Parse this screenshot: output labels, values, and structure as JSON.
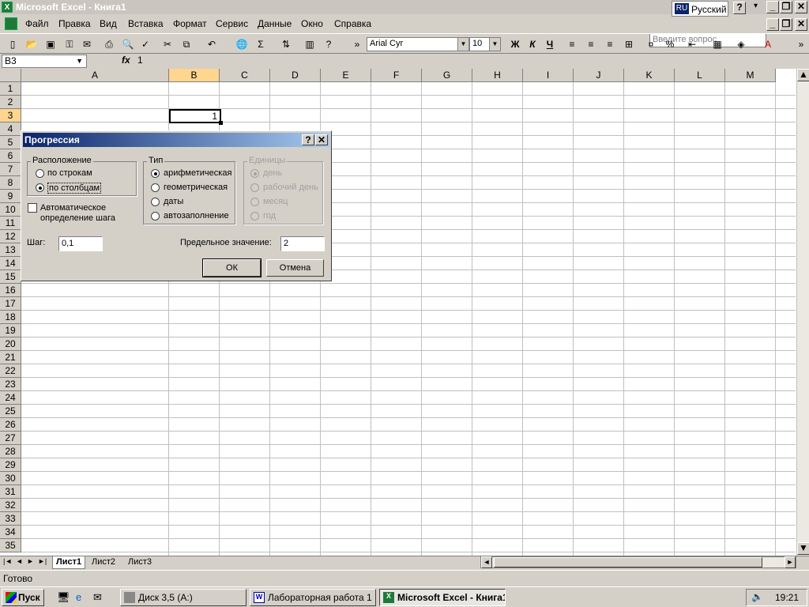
{
  "window": {
    "title": "Microsoft Excel - Книга1",
    "language": "Русский",
    "lang_code": "RU",
    "min": "_",
    "restore": "❐",
    "close": "✕",
    "help": "?",
    "dropdown": "▾"
  },
  "menu": {
    "items": [
      "Файл",
      "Правка",
      "Вид",
      "Вставка",
      "Формат",
      "Сервис",
      "Данные",
      "Окно",
      "Справка"
    ],
    "ask_placeholder": "Введите вопрос"
  },
  "toolbar": {
    "font": "Arial Cyr",
    "size": "10",
    "bold": "Ж",
    "italic": "К",
    "underline": "Ч",
    "sigma": "Σ",
    "percent": "%"
  },
  "formula_bar": {
    "name_box": "B3",
    "fx": "fx",
    "value": "1"
  },
  "sheet": {
    "columns": [
      "A",
      "B",
      "C",
      "D",
      "E",
      "F",
      "G",
      "H",
      "I",
      "J",
      "K",
      "L",
      "M"
    ],
    "rows": [
      "1",
      "2",
      "3",
      "4",
      "5",
      "6",
      "7",
      "8",
      "9",
      "10",
      "11",
      "12",
      "13",
      "14",
      "15",
      "16",
      "17",
      "18",
      "19",
      "20",
      "21",
      "22",
      "23",
      "24",
      "25",
      "26",
      "27",
      "28",
      "29",
      "30",
      "31",
      "32",
      "33",
      "34",
      "35"
    ],
    "active_cell_value": "1",
    "tabs": [
      "Лист1",
      "Лист2",
      "Лист3"
    ]
  },
  "status": {
    "text": "Готово"
  },
  "dialog": {
    "title": "Прогрессия",
    "help_btn": "?",
    "close_btn": "✕",
    "layout_group": {
      "label": "Расположение",
      "options": [
        "по строкам",
        "по столбцам"
      ],
      "selected": 1
    },
    "type_group": {
      "label": "Тип",
      "options": [
        "арифметическая",
        "геометрическая",
        "даты",
        "автозаполнение"
      ],
      "selected": 0
    },
    "units_group": {
      "label": "Единицы",
      "options": [
        "день",
        "рабочий день",
        "месяц",
        "год"
      ],
      "selected": 0
    },
    "auto_step": {
      "line1": "Автоматическое",
      "line2": "определение шага",
      "checked": false
    },
    "step_label": "Шаг:",
    "step_value": "0,1",
    "limit_label": "Предельное значение:",
    "limit_value": "2",
    "ok": "ОК",
    "cancel": "Отмена"
  },
  "taskbar": {
    "start": "Пуск",
    "tasks": [
      "Диск 3,5 (A:)",
      "Лабораторная работа 1 ...",
      "Microsoft Excel - Книга1"
    ],
    "clock": "19:21"
  }
}
